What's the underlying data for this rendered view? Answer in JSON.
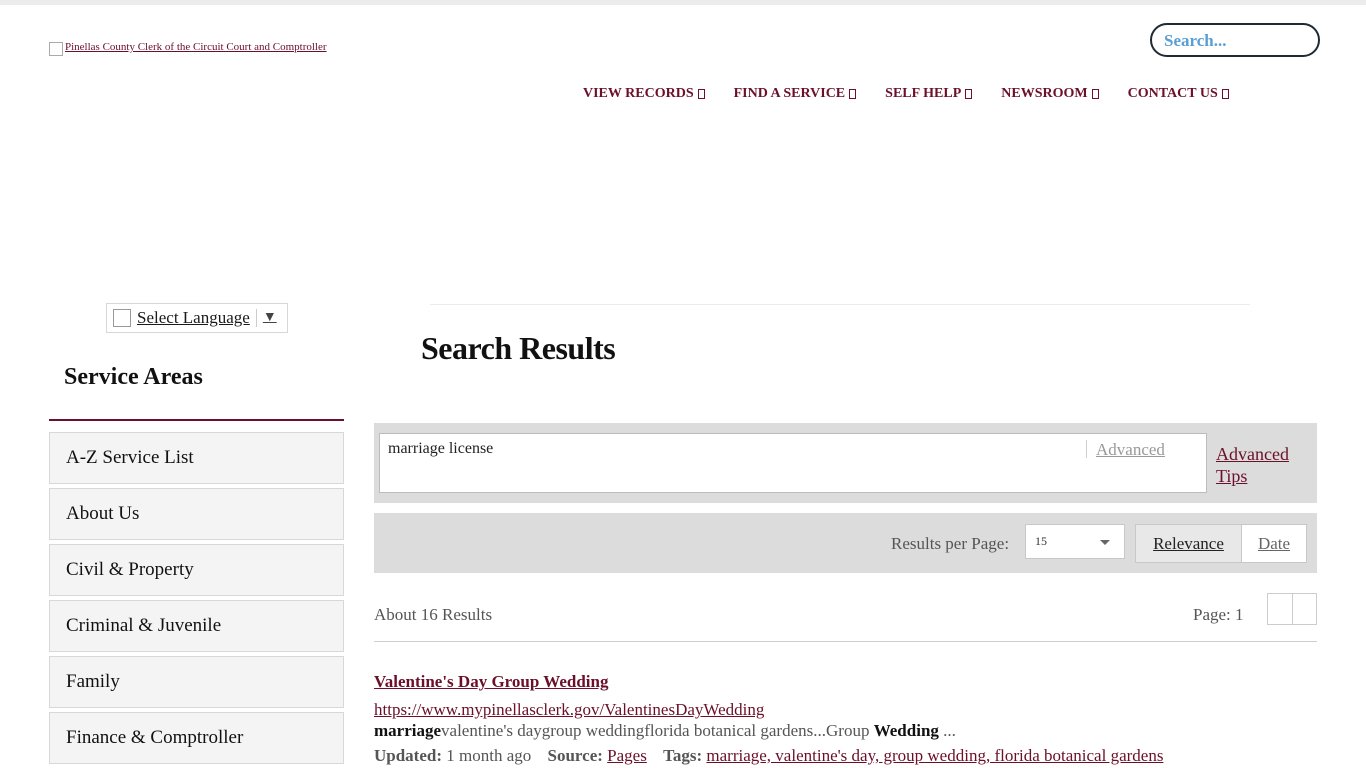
{
  "header": {
    "logo_alt": "Pinellas County Clerk of the Circuit Court and Comptroller",
    "search_placeholder": "Search...",
    "nav": [
      {
        "label": "VIEW RECORDS"
      },
      {
        "label": "FIND A SERVICE"
      },
      {
        "label": "SELF HELP"
      },
      {
        "label": "NEWSROOM"
      },
      {
        "label": "CONTACT US"
      }
    ]
  },
  "language": {
    "label": "Select Language",
    "arrow": "▼"
  },
  "sidebar": {
    "title": "Service Areas",
    "items": [
      {
        "label": "A-Z Service List"
      },
      {
        "label": "About Us"
      },
      {
        "label": "Civil & Property"
      },
      {
        "label": "Criminal & Juvenile"
      },
      {
        "label": "Family"
      },
      {
        "label": "Finance & Comptroller"
      }
    ]
  },
  "main": {
    "title": "Search Results",
    "query": {
      "value": "marriage license",
      "advanced_label": "Advanced",
      "advanced_tips_label": "Advanced Tips"
    },
    "controls": {
      "results_per_page_label": "Results per Page:",
      "results_per_page_value": "15",
      "sort_relevance": "Relevance",
      "sort_date": "Date"
    },
    "summary": {
      "count_text": "About 16 Results",
      "page_text": "Page: 1"
    },
    "results": [
      {
        "title": "Valentine's Day Group Wedding",
        "url": "https://www.mypinellasclerk.gov/ValentinesDayWedding",
        "snippet_bold_1": "marriage",
        "snippet_text_1": "valentine's daygroup weddingflorida botanical gardens...Group ",
        "snippet_bold_2": "Wedding",
        "snippet_text_2": " ...",
        "updated_label": "Updated:",
        "updated_value": "1 month ago",
        "source_label": "Source:",
        "source_value": "Pages",
        "tags_label": "Tags:",
        "tags_value": "marriage, valentine's day, group wedding, florida botanical gardens"
      }
    ]
  },
  "colors": {
    "brand": "#6b0f2a",
    "search_text": "#4a90c8",
    "panel_bg": "#dcdcdc"
  }
}
